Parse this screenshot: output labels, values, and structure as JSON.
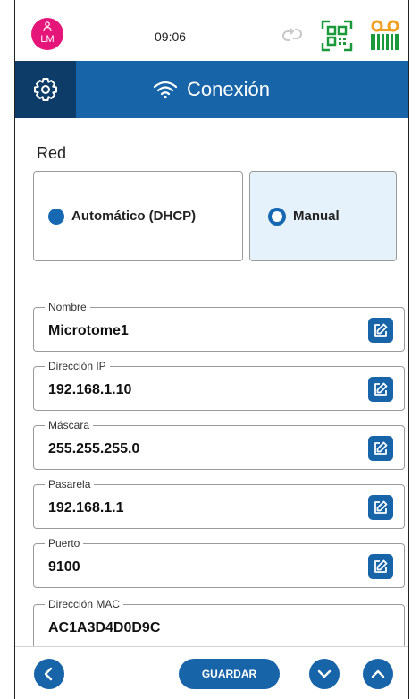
{
  "status": {
    "avatar_initials": "LM",
    "time": "09:06",
    "icons": [
      "person-icon",
      "sync-icon",
      "qr-icon",
      "tape-icon"
    ],
    "colors": {
      "avatar": "#e5157a",
      "qr": "#1a9a3a",
      "tape_top": "#f0a020",
      "tape_bottom": "#1a9a3a"
    }
  },
  "header": {
    "title": "Conexión",
    "icons": [
      "gear-icon",
      "wifi-icon"
    ],
    "colors": {
      "bar": "#1764a9",
      "gear_box": "#0d3c69"
    }
  },
  "network": {
    "section_label": "Red",
    "options": [
      {
        "label": "Automático (DHCP)",
        "selected": false
      },
      {
        "label": "Manual",
        "selected": true
      }
    ]
  },
  "fields": [
    {
      "label": "Nombre",
      "value": "Microtome1",
      "editable": true
    },
    {
      "label": "Dirección IP",
      "value": "192.168.1.10",
      "editable": true
    },
    {
      "label": "Máscara",
      "value": "255.255.255.0",
      "editable": true
    },
    {
      "label": "Pasarela",
      "value": "192.168.1.1",
      "editable": true
    },
    {
      "label": "Puerto",
      "value": "9100",
      "editable": true
    },
    {
      "label": "Dirección MAC",
      "value": "AC1A3D4D0D9C",
      "editable": false
    }
  ],
  "footer": {
    "save_label": "GUARDAR",
    "icons": [
      "back-icon",
      "chevron-down-icon",
      "chevron-up-icon"
    ]
  },
  "accent": "#1764a9"
}
